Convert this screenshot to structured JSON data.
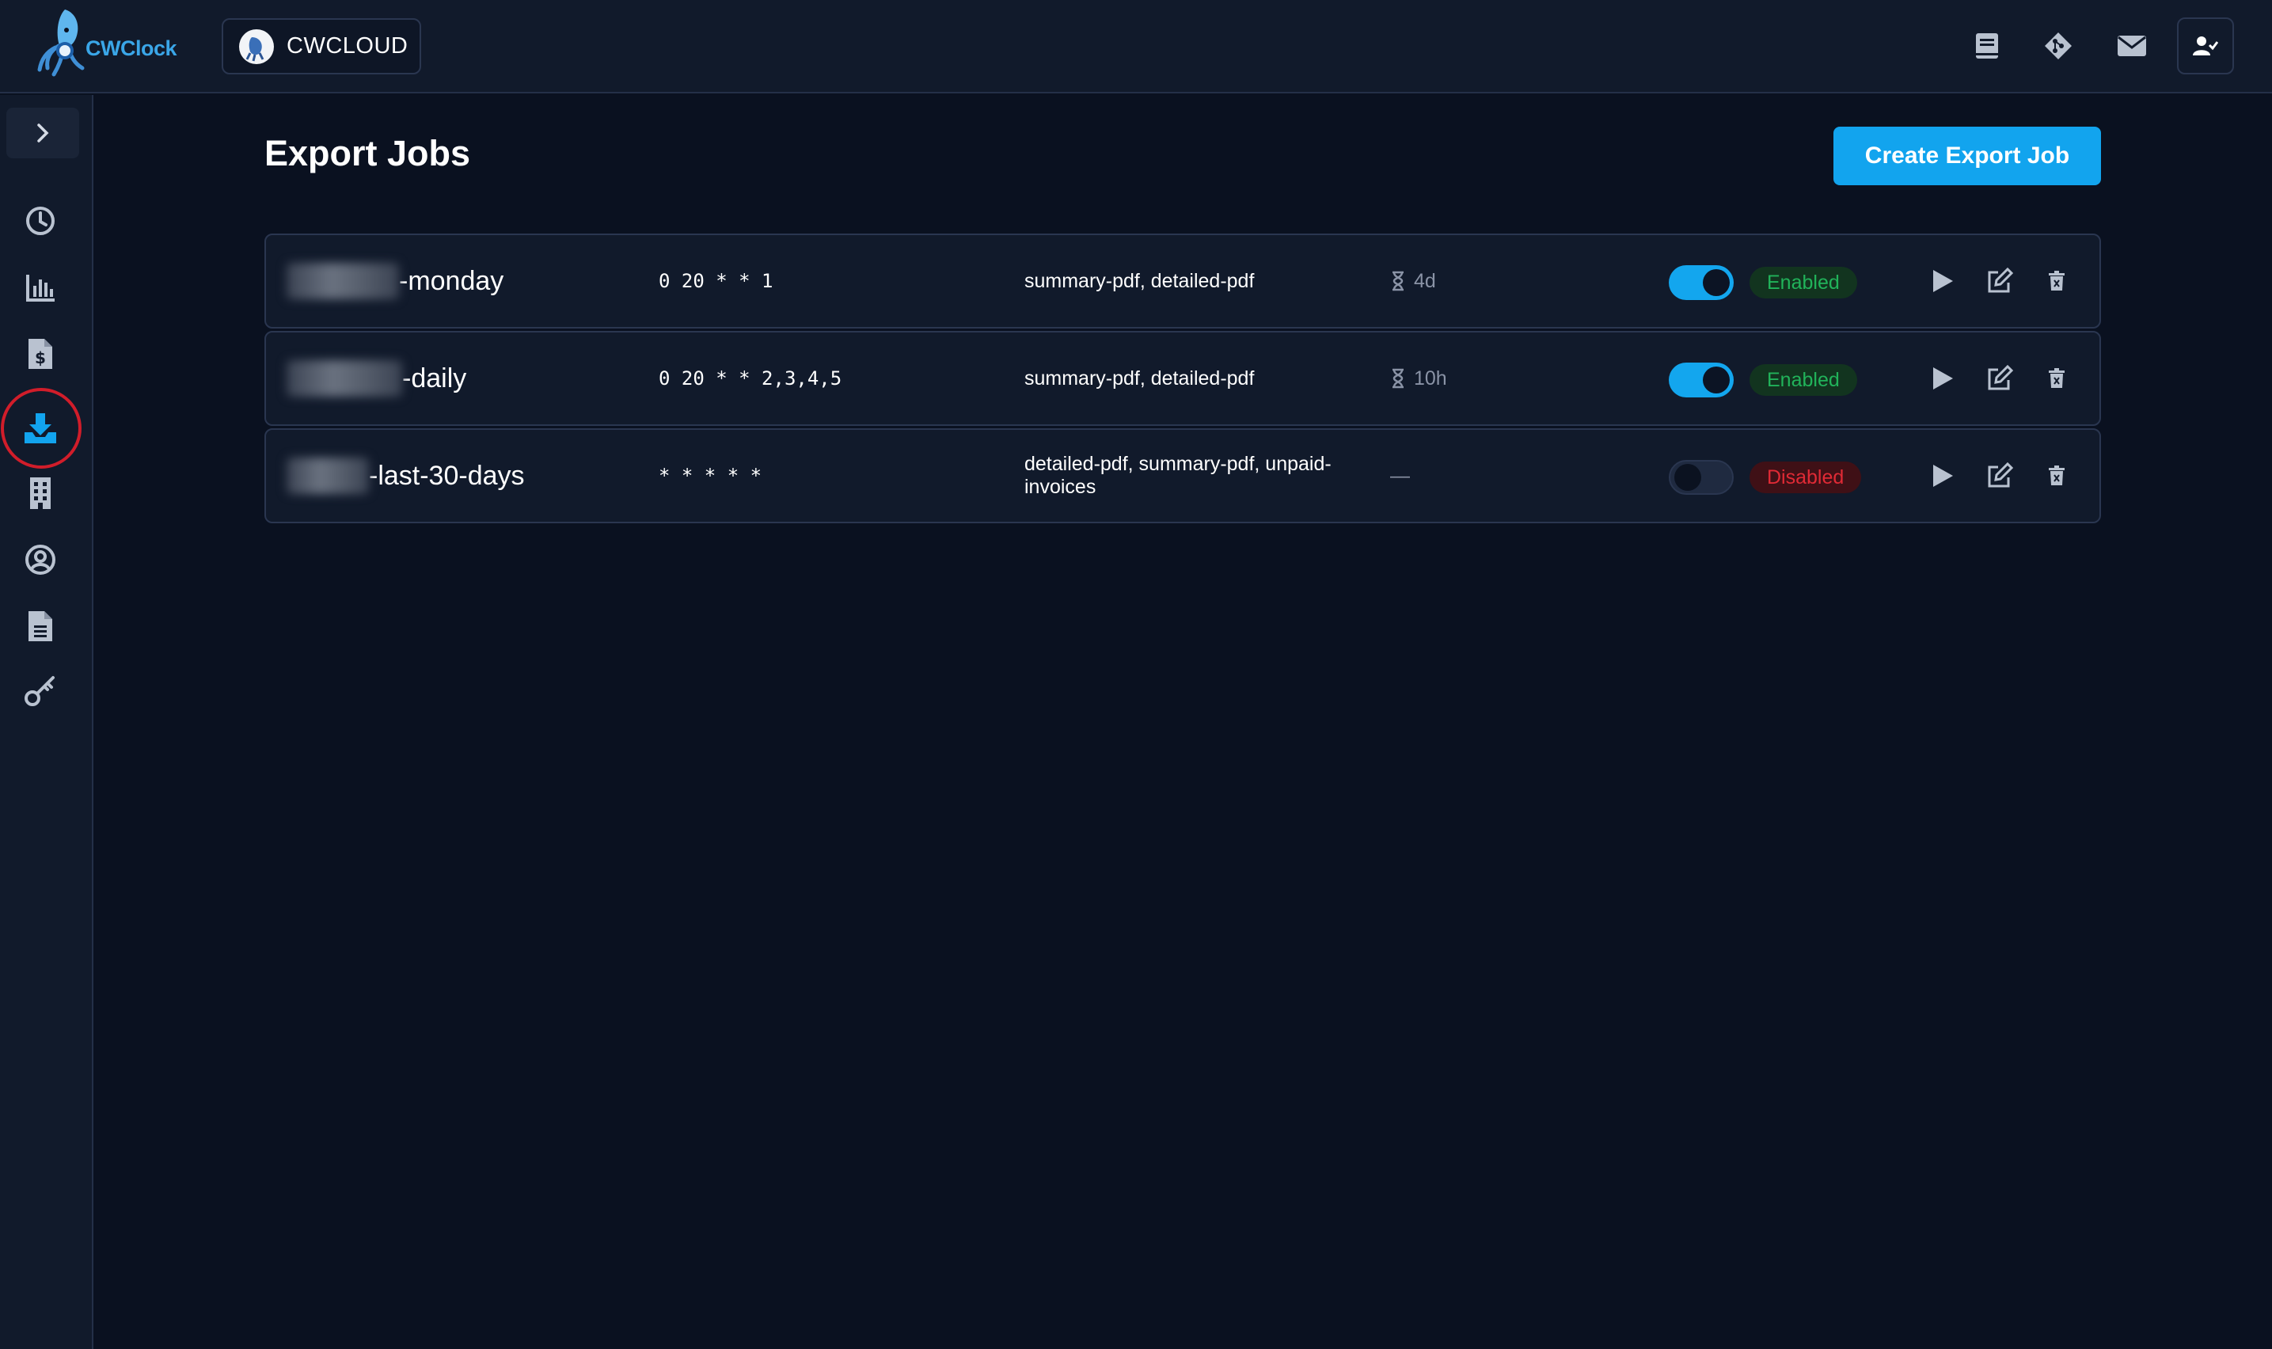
{
  "app": {
    "logo_text": "CWClock",
    "brand": "CWCLOUD"
  },
  "topbar": {
    "icons": [
      "book-icon",
      "git-icon",
      "mail-icon",
      "user-check-icon"
    ]
  },
  "sidebar": {
    "items": [
      {
        "icon": "expand-chevron-icon"
      },
      {
        "icon": "clock-icon"
      },
      {
        "icon": "chart-bar-icon"
      },
      {
        "icon": "invoice-dollar-icon"
      },
      {
        "icon": "download-tray-icon",
        "active": true
      },
      {
        "icon": "building-icon"
      },
      {
        "icon": "user-circle-icon"
      },
      {
        "icon": "document-icon"
      },
      {
        "icon": "key-icon"
      }
    ],
    "accent": "#12a4ee",
    "highlight_ring": "#d11d2a"
  },
  "page": {
    "title": "Export Jobs",
    "create_button": "Create Export Job"
  },
  "jobs": [
    {
      "name_suffix": "-monday",
      "cron": "0 20 * * 1",
      "formats": "summary-pdf, detailed-pdf",
      "remaining": "4d",
      "enabled": true,
      "status": "Enabled"
    },
    {
      "name_suffix": "-daily",
      "cron": "0 20 * * 2,3,4,5",
      "formats": "summary-pdf, detailed-pdf",
      "remaining": "10h",
      "enabled": true,
      "status": "Enabled"
    },
    {
      "name_suffix": "-last-30-days",
      "cron": "* * * * *",
      "formats": "detailed-pdf, summary-pdf, unpaid-invoices",
      "remaining": "—",
      "enabled": false,
      "status": "Disabled"
    }
  ],
  "colors": {
    "background": "#0a1120",
    "panel": "#111a2b",
    "primary": "#12a4ee",
    "enabled": "#21b35a",
    "disabled": "#e02a35"
  }
}
